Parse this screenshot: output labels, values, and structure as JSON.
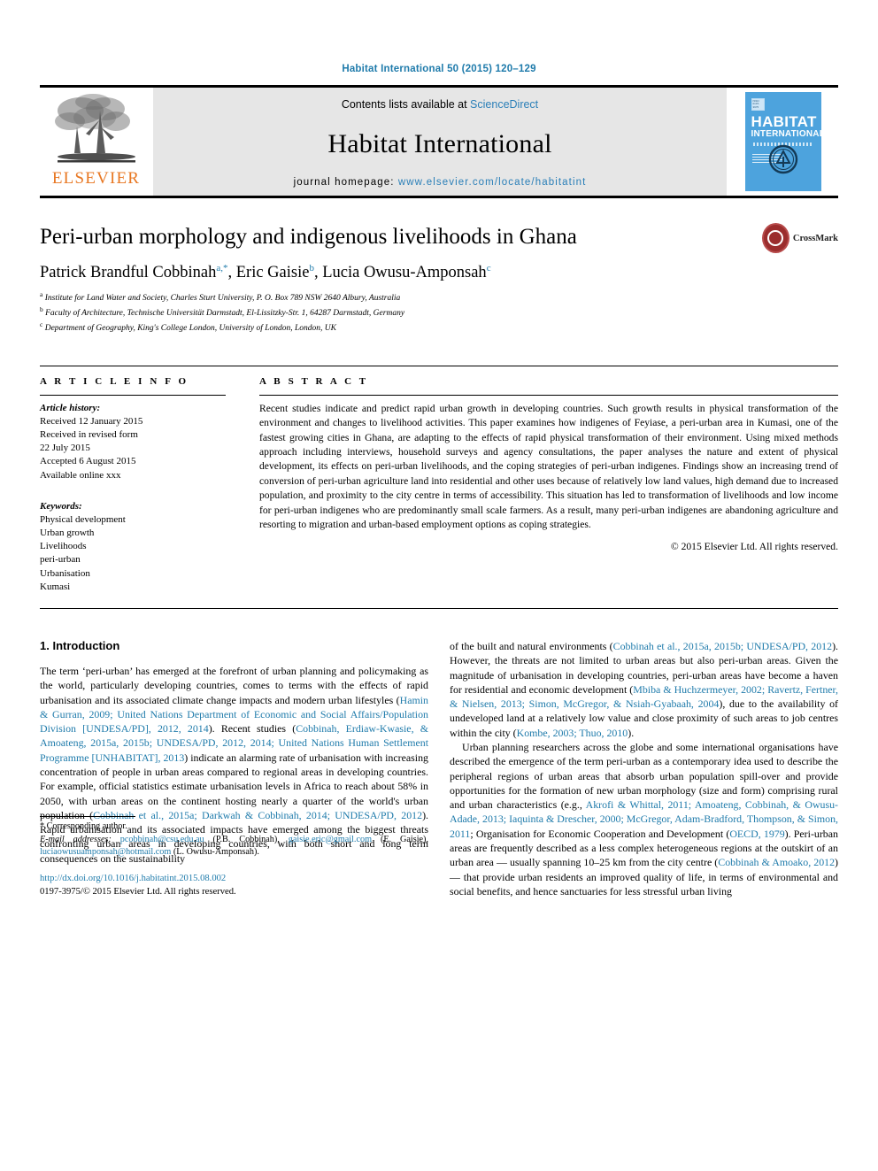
{
  "running_head": "Habitat International 50 (2015) 120–129",
  "masthead": {
    "publisher_name": "ELSEVIER",
    "contents_prefix": "Contents lists available at ",
    "contents_link": "ScienceDirect",
    "journal_name": "Habitat International",
    "homepage_label": "journal homepage: ",
    "homepage_url": "www.elsevier.com/locate/habitatint",
    "cover": {
      "title_line1": "HABITAT",
      "title_line2": "INTERNATIONAL"
    }
  },
  "article": {
    "title": "Peri-urban morphology and indigenous livelihoods in Ghana",
    "authors": [
      {
        "name": "Patrick Brandful Cobbinah",
        "marks": "a,*"
      },
      {
        "name": "Eric Gaisie",
        "marks": "b"
      },
      {
        "name": "Lucia Owusu-Amponsah",
        "marks": "c"
      }
    ],
    "affiliations": [
      {
        "mark": "a",
        "text": "Institute for Land Water and Society, Charles Sturt University, P. O. Box 789 NSW 2640 Albury, Australia"
      },
      {
        "mark": "b",
        "text": "Faculty of Architecture, Technische Universität Darmstadt, El-Lissitzky-Str. 1, 64287 Darmstadt, Germany"
      },
      {
        "mark": "c",
        "text": "Department of Geography, King's College London, University of London, London, UK"
      }
    ],
    "crossmark_label": "CrossMark"
  },
  "article_info": {
    "heading": "A R T I C L E   I N F O",
    "history_label": "Article history:",
    "history": [
      "Received 12 January 2015",
      "Received in revised form",
      "22 July 2015",
      "Accepted 6 August 2015",
      "Available online xxx"
    ],
    "keywords_label": "Keywords:",
    "keywords": [
      "Physical development",
      "Urban growth",
      "Livelihoods",
      "peri-urban",
      "Urbanisation",
      "Kumasi"
    ]
  },
  "abstract": {
    "heading": "A B S T R A C T",
    "text": "Recent studies indicate and predict rapid urban growth in developing countries. Such growth results in physical transformation of the environment and changes to livelihood activities. This paper examines how indigenes of Feyiase, a peri-urban area in Kumasi, one of the fastest growing cities in Ghana, are adapting to the effects of rapid physical transformation of their environment. Using mixed methods approach including interviews, household surveys and agency consultations, the paper analyses the nature and extent of physical development, its effects on peri-urban livelihoods, and the coping strategies of peri-urban indigenes. Findings show an increasing trend of conversion of peri-urban agriculture land into residential and other uses because of relatively low land values, high demand due to increased population, and proximity to the city centre in terms of accessibility. This situation has led to transformation of livelihoods and low income for peri-urban indigenes who are predominantly small scale farmers. As a result, many peri-urban indigenes are abandoning agriculture and resorting to migration and urban-based employment options as coping strategies.",
    "copyright": "© 2015 Elsevier Ltd. All rights reserved."
  },
  "introduction": {
    "heading": "1. Introduction",
    "left_paragraphs": [
      {
        "segments": [
          {
            "t": "The term ‘peri-urban’ has emerged at the forefront of urban planning and policymaking as the world, particularly developing countries, comes to terms with the effects of rapid urbanisation and its associated climate change impacts and modern urban lifestyles (",
            "link": false
          },
          {
            "t": "Hamin & Gurran, 2009; United Nations Department of Economic and Social Affairs/Population Division [UNDESA/PD], 2012, 2014",
            "link": true
          },
          {
            "t": "). Recent studies (",
            "link": false
          },
          {
            "t": "Cobbinah, Erdiaw-Kwasie, & Amoateng, 2015a, 2015b; UNDESA/PD, 2012, 2014; United Nations Human Settlement Programme [UNHABITAT], 2013",
            "link": true
          },
          {
            "t": ") indicate an alarming rate of urbanisation with increasing concentration of people in urban areas compared to regional areas in developing countries. For example, official statistics estimate urbanisation levels in Africa to reach about 58% in 2050, with urban areas on the continent hosting nearly a quarter of the world's urban population (",
            "link": false
          },
          {
            "t": "Cobbinah et al., 2015a; Darkwah & Cobbinah, 2014; UNDESA/PD, 2012",
            "link": true
          },
          {
            "t": "). Rapid urbanisation and its associated impacts have emerged among the biggest threats confronting urban areas in developing countries, with both short and long term consequences on the sustainability",
            "link": false
          }
        ]
      }
    ],
    "right_paragraphs": [
      {
        "indent": false,
        "segments": [
          {
            "t": "of the built and natural environments (",
            "link": false
          },
          {
            "t": "Cobbinah et al., 2015a, 2015b; UNDESA/PD, 2012",
            "link": true
          },
          {
            "t": "). However, the threats are not limited to urban areas but also peri-urban areas. Given the magnitude of urbanisation in developing countries, peri-urban areas have become a haven for residential and economic development (",
            "link": false
          },
          {
            "t": "Mbiba & Huchzermeyer, 2002; Ravertz, Fertner, & Nielsen, 2013; Simon, McGregor, & Nsiah-Gyabaah, 2004",
            "link": true
          },
          {
            "t": "), due to the availability of undeveloped land at a relatively low value and close proximity of such areas to job centres within the city (",
            "link": false
          },
          {
            "t": "Kombe, 2003; Thuo, 2010",
            "link": true
          },
          {
            "t": ").",
            "link": false
          }
        ]
      },
      {
        "indent": true,
        "segments": [
          {
            "t": "Urban planning researchers across the globe and some international organisations have described the emergence of the term peri-urban as a contemporary idea used to describe the peripheral regions of urban areas that absorb urban population spill-over and provide opportunities for the formation of new urban morphology (size and form) comprising rural and urban characteristics (e.g., ",
            "link": false
          },
          {
            "t": "Akrofi & Whittal, 2011; Amoateng, Cobbinah, & Owusu-Adade, 2013; Iaquinta & Drescher, 2000; McGregor, Adam-Bradford, Thompson, & Simon, 2011",
            "link": true
          },
          {
            "t": "; Organisation for Economic Cooperation and Development (",
            "link": false
          },
          {
            "t": "OECD, 1979",
            "link": true
          },
          {
            "t": "). Peri-urban areas are frequently described as a less complex heterogeneous regions at the outskirt of an urban area — usually spanning 10–25 km from the city centre (",
            "link": false
          },
          {
            "t": "Cobbinah & Amoako, 2012",
            "link": true
          },
          {
            "t": ") — that provide urban residents an improved quality of life, in terms of environmental and social benefits, and hence sanctuaries for less stressful urban living",
            "link": false
          }
        ]
      }
    ]
  },
  "footnotes": {
    "corresponding": "* Corresponding author.",
    "email_label": "E-mail addresses:",
    "emails": [
      {
        "address": "pcobbinah@csu.edu.au",
        "person": "(P.B. Cobbinah)"
      },
      {
        "address": "gaisie.eric@gmail.com",
        "person": "(E. Gaisie)"
      },
      {
        "address": "luciaowusuamponsah@hotmail.com",
        "person": "(L. Owusu-Amponsah)"
      }
    ],
    "doi": "http://dx.doi.org/10.1016/j.habitatint.2015.08.002",
    "issn_line": "0197-3975/© 2015 Elsevier Ltd. All rights reserved."
  }
}
